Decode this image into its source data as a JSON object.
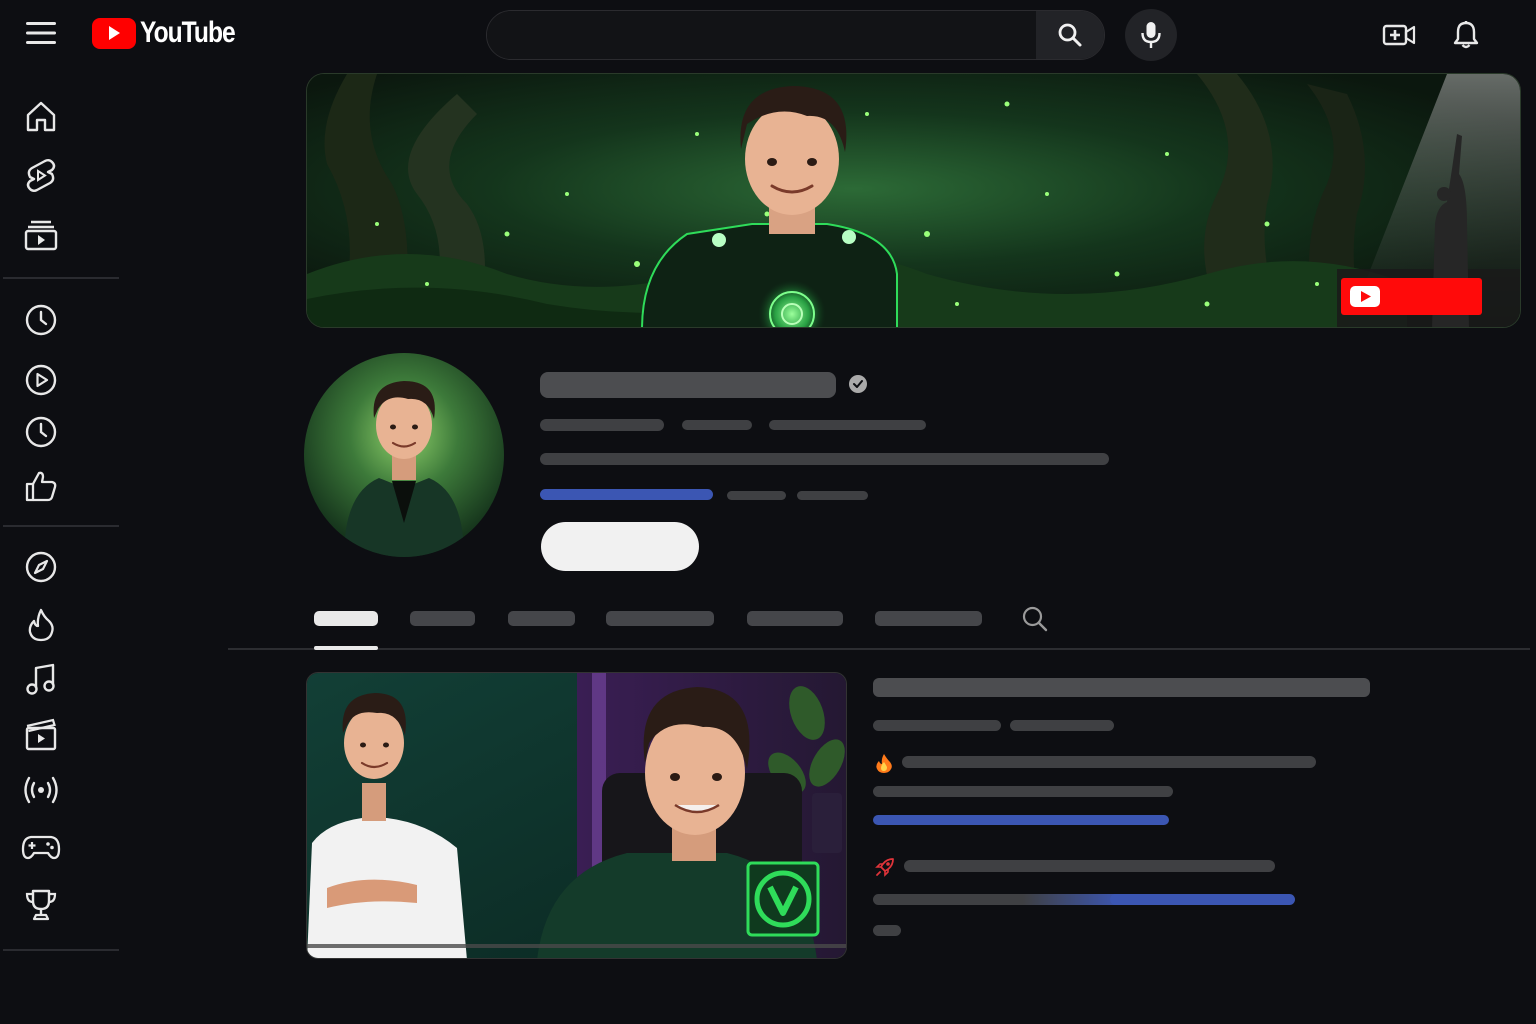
{
  "topbar": {
    "logo_text": "YouTube",
    "search_placeholder": "",
    "icons": [
      "menu-icon",
      "youtube-logo-icon",
      "search-icon",
      "microphone-icon",
      "create-video-icon",
      "bell-icon"
    ]
  },
  "sidebar": {
    "items": [
      {
        "icon": "home-icon"
      },
      {
        "icon": "shorts-icon"
      },
      {
        "icon": "subscriptions-icon"
      },
      {
        "icon": "history-icon"
      },
      {
        "icon": "your-videos-icon"
      },
      {
        "icon": "watch-later-icon"
      },
      {
        "icon": "liked-videos-icon"
      },
      {
        "icon": "explore-icon"
      },
      {
        "icon": "trending-icon"
      },
      {
        "icon": "music-icon"
      },
      {
        "icon": "movies-icon"
      },
      {
        "icon": "live-icon"
      },
      {
        "icon": "gaming-icon"
      },
      {
        "icon": "trophy-icon"
      }
    ]
  },
  "channel": {
    "subscribe_label": "",
    "verified_icon": "verified-check-icon"
  },
  "featured": {
    "emoji_1": "🔥",
    "emoji_2": "🚀"
  },
  "colors": {
    "background": "#0d0e12",
    "accent_red": "#ff0000",
    "placeholder_blue": "#3b56b3",
    "placeholder_gray": "#3f4043"
  }
}
